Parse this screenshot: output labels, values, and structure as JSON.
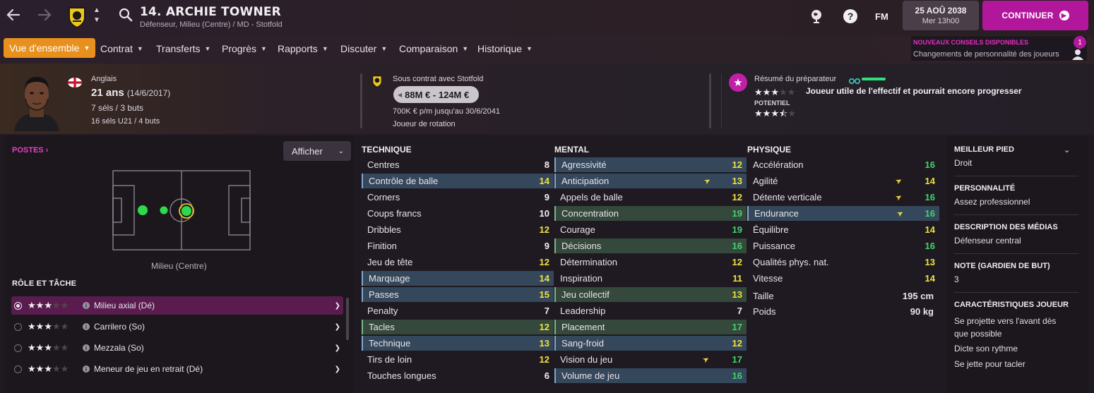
{
  "header": {
    "player_title": "14. ARCHIE TOWNER",
    "player_subtitle": "Défenseur, Milieu (Centre) / MD - Stotfold",
    "back_icon": "arrow-left",
    "forward_icon": "arrow-right",
    "help_label": "?",
    "fm_label": "FM",
    "date_main": "25 AOÛ 2038",
    "date_sub": "Mer 13h00",
    "continue_label": "CONTINUER"
  },
  "nav": {
    "tabs": [
      {
        "label": "Vue d'ensemble",
        "active": true
      },
      {
        "label": "Contrat"
      },
      {
        "label": "Transferts"
      },
      {
        "label": "Progrès"
      },
      {
        "label": "Rapports"
      },
      {
        "label": "Discuter"
      },
      {
        "label": "Comparaison"
      },
      {
        "label": "Historique"
      }
    ]
  },
  "advice": {
    "title": "NOUVEAUX CONSEILS DISPONIBLES",
    "text": "Changements de personnalité des joueurs",
    "count": "1"
  },
  "profile": {
    "nationality": "Anglais",
    "age": "21 ans",
    "dob": "(14/6/2017)",
    "caps": "7 séls / 3 buts",
    "u21_caps": "16 séls U21 / 4 buts",
    "contract_with": "Sous contrat avec Stotfold",
    "value": "88M € - 124M €",
    "wage": "700K € p/m jusqu'au 30/6/2041",
    "squad_status": "Joueur de rotation",
    "coach_summary_label": "Résumé du préparateur",
    "coach_summary": "Joueur utile de l'effectif et pourrait encore progresser",
    "ability_stars": 3,
    "potential_label": "POTENTIEL",
    "potential_stars": 3.5
  },
  "positions": {
    "title": "POSTES",
    "show_label": "Afficher",
    "position_label": "Milieu (Centre)"
  },
  "roles": {
    "title": "RÔLE ET TÂCHE",
    "items": [
      {
        "label": "Milieu axial (Dé)",
        "stars": 3,
        "selected": true
      },
      {
        "label": "Carrilero (So)",
        "stars": 3,
        "selected": false
      },
      {
        "label": "Mezzala (So)",
        "stars": 3,
        "selected": false
      },
      {
        "label": "Meneur de jeu en retrait (Dé)",
        "stars": 3,
        "selected": false
      }
    ]
  },
  "technique": {
    "title": "TECHNIQUE",
    "rows": [
      {
        "name": "Centres",
        "value": "8",
        "hl": "",
        "color": "white"
      },
      {
        "name": "Contrôle de balle",
        "value": "14",
        "hl": "blue",
        "color": "yellow"
      },
      {
        "name": "Corners",
        "value": "9",
        "hl": "",
        "color": "white"
      },
      {
        "name": "Coups francs",
        "value": "10",
        "hl": "",
        "color": "white"
      },
      {
        "name": "Dribbles",
        "value": "12",
        "hl": "",
        "color": "yellow"
      },
      {
        "name": "Finition",
        "value": "9",
        "hl": "",
        "color": "white"
      },
      {
        "name": "Jeu de tête",
        "value": "12",
        "hl": "",
        "color": "yellow"
      },
      {
        "name": "Marquage",
        "value": "14",
        "hl": "blue",
        "color": "yellow"
      },
      {
        "name": "Passes",
        "value": "15",
        "hl": "blue",
        "color": "yellow"
      },
      {
        "name": "Penalty",
        "value": "7",
        "hl": "",
        "color": "white"
      },
      {
        "name": "Tacles",
        "value": "12",
        "hl": "green",
        "color": "yellow"
      },
      {
        "name": "Technique",
        "value": "13",
        "hl": "blue",
        "color": "yellow"
      },
      {
        "name": "Tirs de loin",
        "value": "12",
        "hl": "",
        "color": "yellow"
      },
      {
        "name": "Touches longues",
        "value": "6",
        "hl": "",
        "color": "white"
      }
    ]
  },
  "mental": {
    "title": "MENTAL",
    "rows": [
      {
        "name": "Agressivité",
        "value": "12",
        "hl": "blue",
        "color": "yellow"
      },
      {
        "name": "Anticipation",
        "value": "13",
        "hl": "blue",
        "color": "yellow",
        "arrow": true
      },
      {
        "name": "Appels de balle",
        "value": "12",
        "hl": "",
        "color": "yellow"
      },
      {
        "name": "Concentration",
        "value": "19",
        "hl": "green",
        "color": "green"
      },
      {
        "name": "Courage",
        "value": "19",
        "hl": "",
        "color": "green"
      },
      {
        "name": "Décisions",
        "value": "16",
        "hl": "green",
        "color": "green"
      },
      {
        "name": "Détermination",
        "value": "12",
        "hl": "",
        "color": "yellow"
      },
      {
        "name": "Inspiration",
        "value": "11",
        "hl": "",
        "color": "yellow"
      },
      {
        "name": "Jeu collectif",
        "value": "13",
        "hl": "green",
        "color": "yellow"
      },
      {
        "name": "Leadership",
        "value": "7",
        "hl": "",
        "color": "white"
      },
      {
        "name": "Placement",
        "value": "17",
        "hl": "green",
        "color": "green"
      },
      {
        "name": "Sang-froid",
        "value": "12",
        "hl": "blue",
        "color": "yellow"
      },
      {
        "name": "Vision du jeu",
        "value": "17",
        "hl": "",
        "color": "green",
        "arrow": true
      },
      {
        "name": "Volume de jeu",
        "value": "16",
        "hl": "blue",
        "color": "green"
      }
    ]
  },
  "physique": {
    "title": "PHYSIQUE",
    "rows": [
      {
        "name": "Accélération",
        "value": "16",
        "hl": "",
        "color": "green"
      },
      {
        "name": "Agilité",
        "value": "14",
        "hl": "",
        "color": "yellow",
        "arrow": true
      },
      {
        "name": "Détente verticale",
        "value": "16",
        "hl": "",
        "color": "green",
        "arrow": true
      },
      {
        "name": "Endurance",
        "value": "16",
        "hl": "blue",
        "color": "green",
        "arrow": true
      },
      {
        "name": "Équilibre",
        "value": "14",
        "hl": "",
        "color": "yellow"
      },
      {
        "name": "Puissance",
        "value": "16",
        "hl": "",
        "color": "green"
      },
      {
        "name": "Qualités phys. nat.",
        "value": "13",
        "hl": "",
        "color": "yellow"
      },
      {
        "name": "Vitesse",
        "value": "14",
        "hl": "",
        "color": "yellow"
      }
    ],
    "height_label": "Taille",
    "height_value": "195 cm",
    "weight_label": "Poids",
    "weight_value": "90 kg"
  },
  "info": {
    "best_foot_title": "MEILLEUR PIED",
    "best_foot": "Droit",
    "personality_title": "PERSONNALITÉ",
    "personality": "Assez professionnel",
    "media_title": "DESCRIPTION DES MÉDIAS",
    "media": "Défenseur central",
    "gk_title": "NOTE (GARDIEN DE BUT)",
    "gk": "3",
    "traits_title": "CARACTÉRISTIQUES JOUEUR",
    "traits": [
      "Se projette vers l'avant dès que possible",
      "Dicte son rythme",
      "Se jette pour tacler"
    ]
  },
  "colors": {
    "accent_orange": "#e8901e",
    "continue_magenta": "#b2179b",
    "value_yellow": "#f0e23f",
    "value_green": "#3fd46a"
  }
}
